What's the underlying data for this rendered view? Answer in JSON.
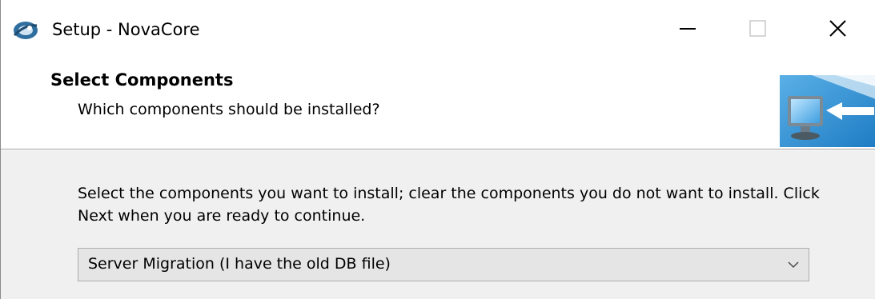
{
  "window": {
    "title": "Setup - NovaCore",
    "controls": {
      "minimize": "minimize-icon",
      "maximize": "maximize-icon",
      "close": "close-icon"
    }
  },
  "header": {
    "title": "Select Components",
    "subtitle": "Which components should be installed?"
  },
  "body": {
    "instructions": "Select the components you want to install; clear the components you do not want to install. Click Next when you are ready to continue.",
    "component_type": {
      "selected": "Server Migration (I have the old DB file)"
    }
  },
  "colors": {
    "body_background": "#f0f0f0",
    "header_background": "#ffffff",
    "combo_background": "#e5e5e5"
  }
}
